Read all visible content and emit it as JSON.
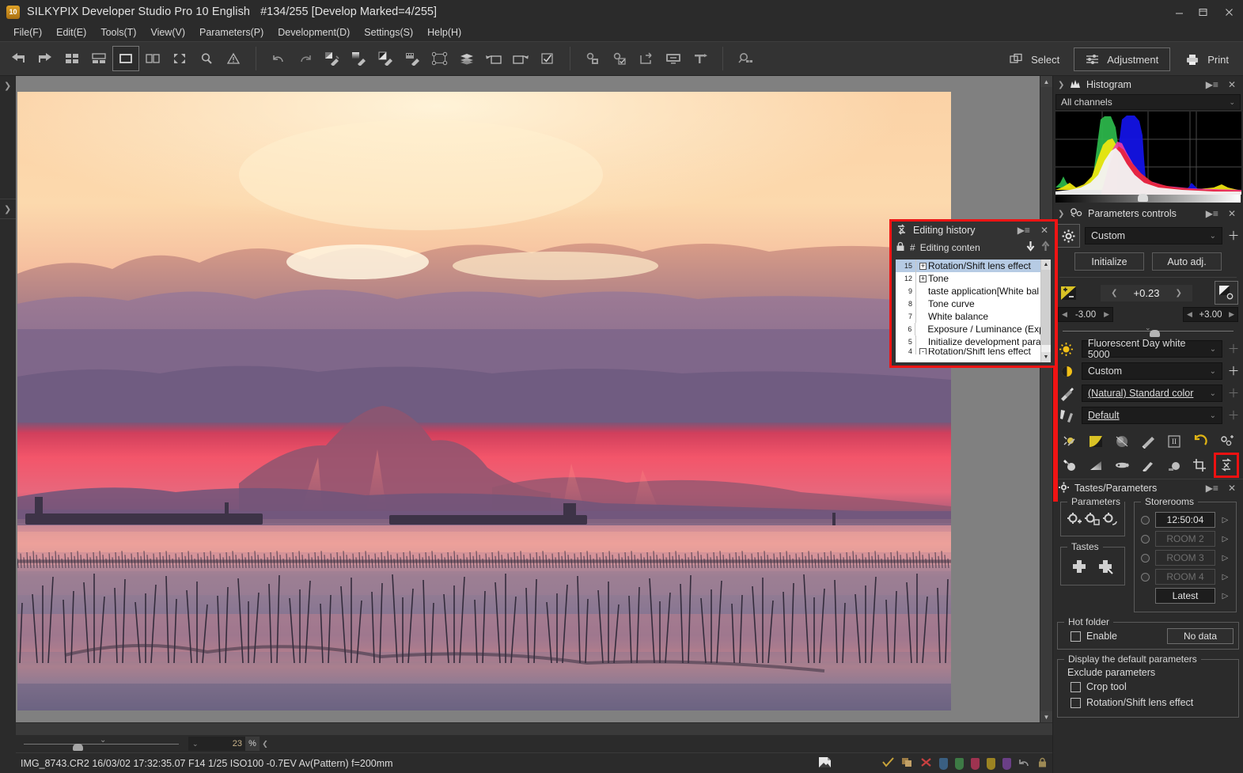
{
  "window": {
    "app_title": "SILKYPIX Developer Studio Pro 10 English",
    "doc_title": "#134/255 [Develop Marked=4/255]",
    "logo_text": "10",
    "minimize": "—",
    "maximize": "❐",
    "close": "✕"
  },
  "menu": [
    {
      "label": "File(F)"
    },
    {
      "label": "Edit(E)"
    },
    {
      "label": "Tools(T)"
    },
    {
      "label": "View(V)"
    },
    {
      "label": "Parameters(P)"
    },
    {
      "label": "Development(D)"
    },
    {
      "label": "Settings(S)"
    },
    {
      "label": "Help(H)"
    }
  ],
  "toolbar": {
    "group1": [
      "back-icon",
      "forward-icon",
      "thumbnail-grid-icon",
      "thumbnail-list-icon",
      "single-view-icon",
      "dual-view-icon",
      "fullscreen-icon",
      "magnifier-icon",
      "warning-icon"
    ],
    "group2": [
      "undo-icon",
      "redo-icon",
      "exposure-dropper-icon",
      "gray-dropper-icon",
      "contrast-dropper-icon",
      "film-dropper-icon",
      "shape-points-icon",
      "layers-icon",
      "rotate-left-icon",
      "rotate-right-icon",
      "checkmark-box-icon"
    ],
    "group3": [
      "save-parameters-icon",
      "apply-parameters-icon",
      "export-icon",
      "display-icon",
      "hammer-icon"
    ],
    "group4": [
      "search-thumbnails-icon"
    ],
    "select_label": "Select",
    "adjustment_label": "Adjustment",
    "print_label": "Print"
  },
  "histogram": {
    "title": "Histogram",
    "channel_value": "All channels",
    "collapse_icon": "chevron-right-icon",
    "menu_icon": "panel-menu-icon",
    "close_icon": "close-icon"
  },
  "parameters_controls": {
    "title": "Parameters controls",
    "preset_value": "Custom",
    "initialize_label": "Initialize",
    "auto_adj_label": "Auto adj.",
    "exposure": {
      "value": "+0.23",
      "min": "-3.00",
      "max": "+3.00"
    },
    "white_balance_value": "Fluorescent Day white 5000",
    "tone_value": "Custom",
    "color_value": "(Natural) Standard color",
    "sharpness_value": "Default",
    "icon_row_1": [
      "exposure-tool-icon",
      "tone-curve-icon",
      "noise-reduction-icon",
      "sharpness-icon",
      "hsv-icon",
      "rotate-reset-icon",
      "fine-color-icon"
    ],
    "icon_row_2": [
      "dodge-burn-icon",
      "gradation-icon",
      "lens-aberration-icon",
      "brush-icon",
      "dehaze-icon",
      "crop-tool-icon",
      "rotation-shift-lens-effect-icon"
    ]
  },
  "tastes_parameters": {
    "title": "Tastes/Parameters",
    "parameters_legend": "Parameters",
    "parameters_icons": [
      "add-parameter-icon",
      "copy-parameter-icon",
      "edit-parameter-icon"
    ],
    "tastes_legend": "Tastes",
    "tastes_icons": [
      "add-taste-icon",
      "edit-taste-icon"
    ],
    "storerooms_legend": "Storerooms",
    "rooms": [
      {
        "label": "12:50:04",
        "active": true
      },
      {
        "label": "ROOM 2",
        "active": false
      },
      {
        "label": "ROOM 3",
        "active": false
      },
      {
        "label": "ROOM 4",
        "active": false
      }
    ],
    "latest_label": "Latest",
    "hot_folder_legend": "Hot folder",
    "hot_folder_enable": "Enable",
    "hot_folder_status": "No data",
    "defaults_legend": "Display the default parameters",
    "exclude_label": "Exclude parameters",
    "exclude_items": [
      "Crop tool",
      "Rotation/Shift lens effect"
    ]
  },
  "editing_history": {
    "title": "Editing history",
    "menu_icon": "panel-menu-icon",
    "close_icon": "close-icon",
    "lock_icon": "lock-icon",
    "col_num": "#",
    "col_content": "Editing conten",
    "down_icon": "arrow-down-icon",
    "up_icon": "arrow-up-icon",
    "rows": [
      {
        "num": "15",
        "label": "Rotation/Shift lens effect",
        "expander": "+",
        "selected": true
      },
      {
        "num": "12",
        "label": "Tone",
        "expander": "+",
        "selected": false
      },
      {
        "num": "9",
        "label": "taste application[White bal",
        "expander": "",
        "selected": false
      },
      {
        "num": "8",
        "label": "Tone curve",
        "expander": "",
        "selected": false
      },
      {
        "num": "7",
        "label": "White balance",
        "expander": "",
        "selected": false
      },
      {
        "num": "6",
        "label": "Exposure / Luminance (Exp",
        "expander": "",
        "selected": false
      },
      {
        "num": "5",
        "label": "Initialize development para",
        "expander": "",
        "selected": false
      },
      {
        "num": "4",
        "label": "Rotation/Shift lens effect",
        "expander": "-",
        "selected": false
      }
    ]
  },
  "zoombar": {
    "zoom_value": "23",
    "percent_label": "%",
    "prev_icon": "chevron-left-icon"
  },
  "statusbar": {
    "info": "IMG_8743.CR2 16/03/02 17:32:35.07 F14 1/25 ISO100 -0.7EV Av(Pattern) f=200mm",
    "icons": [
      "raw-badge-icon",
      "check-icon",
      "copy-icon",
      "delete-icon"
    ],
    "flag_colors": [
      "#3a5f82",
      "#3d7a45",
      "#9e3350",
      "#9b8322",
      "#6a3f86"
    ],
    "trailing_icons": [
      "undo-icon",
      "lock-icon"
    ]
  },
  "colors": {
    "accent_red": "#f01414",
    "panel_bg": "#2b2b2b",
    "toolbar_bg": "#333333",
    "field_bg": "#1c1c1c",
    "selection_blue": "#b6cbe4",
    "canvas_gray": "#808080"
  }
}
